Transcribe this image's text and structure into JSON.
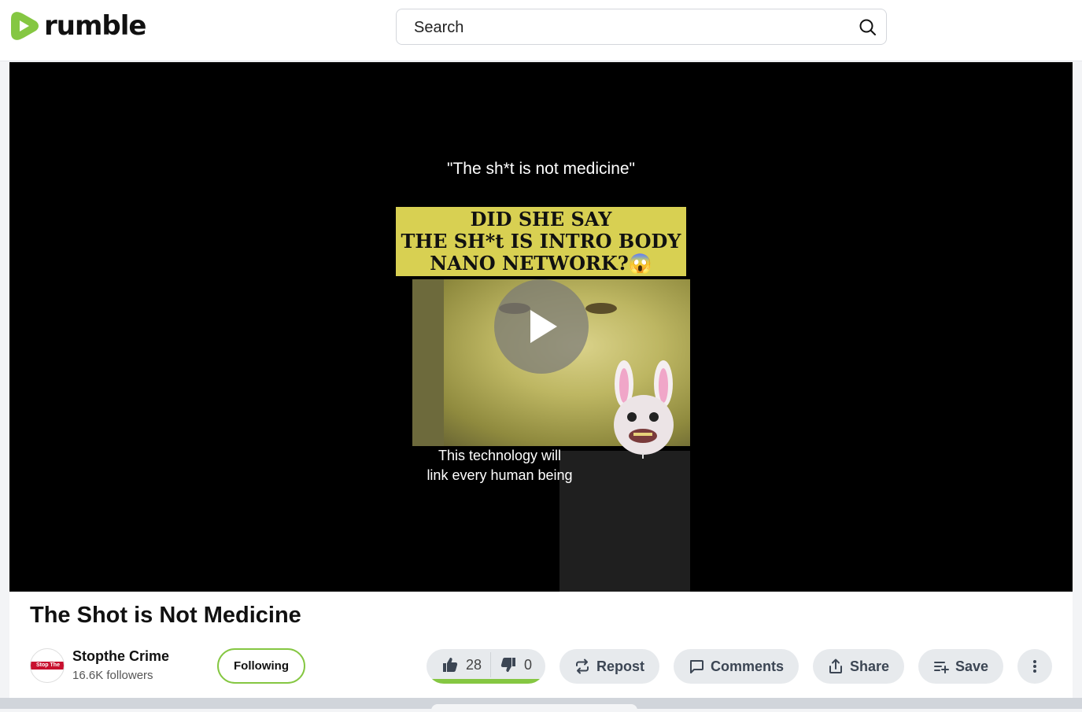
{
  "header": {
    "logo_text": "rumble",
    "search": {
      "placeholder": "Search",
      "icon": "search-icon"
    },
    "brand_color": "#85c742"
  },
  "player": {
    "top_caption": "\"The sh*t is not medicine\"",
    "banner_lines": [
      "DID SHE SAY",
      "THE SH*t IS  INTRO BODY",
      "NANO NETWORK?😱"
    ],
    "subcaption_lines": [
      "This technology will",
      "link every human being"
    ],
    "play_icon": "play-icon"
  },
  "video": {
    "title": "The Shot is Not Medicine",
    "channel": {
      "avatar_text": "Stop The Crime",
      "name": "Stopthe Crime",
      "followers": "16.6K followers",
      "follow_label": "Following"
    },
    "votes": {
      "likes": "28",
      "dislikes": "0",
      "like_ratio": 1.0
    },
    "actions": {
      "repost": "Repost",
      "comments": "Comments",
      "share": "Share",
      "save": "Save"
    }
  }
}
